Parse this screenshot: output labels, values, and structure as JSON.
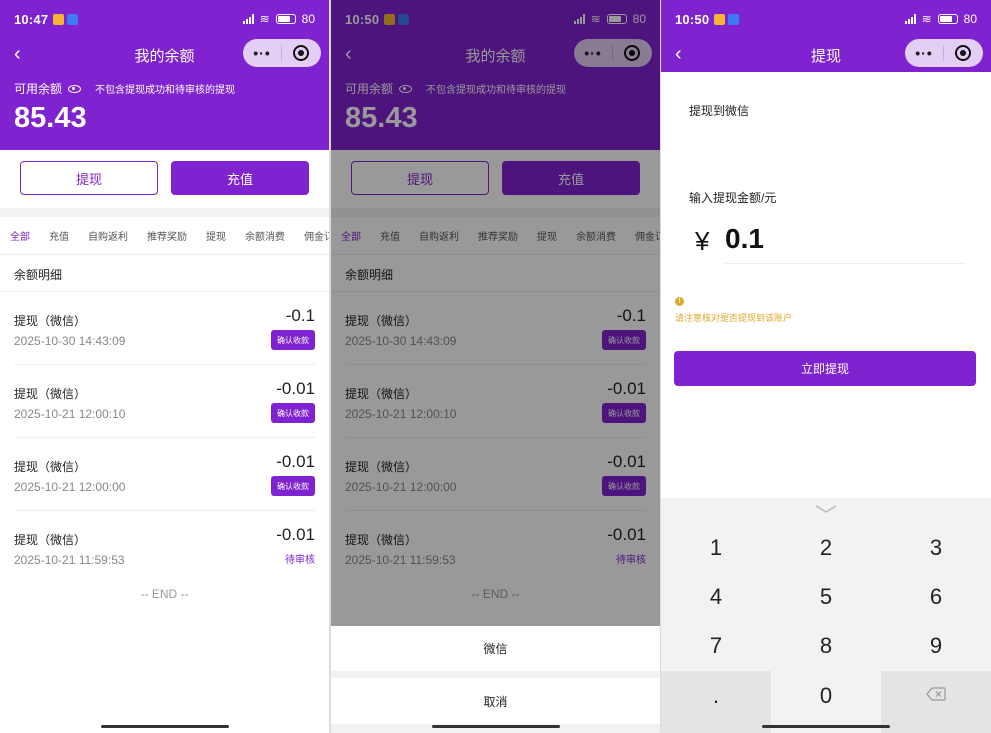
{
  "status_time_1": "10:47",
  "status_time_2": "10:50",
  "status_time_3": "10:50",
  "network": "5G",
  "battery": "80",
  "battery_unit": "%",
  "balance_page": {
    "title": "我的余额",
    "available_label": "可用余额",
    "note": "不包含提现成功和待审核的提现",
    "amount": "85.43",
    "withdraw_label": "提现",
    "recharge_label": "充值",
    "tabs": [
      "全部",
      "充值",
      "自购返利",
      "推荐奖励",
      "提现",
      "余额消费",
      "佣金订"
    ],
    "section_title": "余额明细",
    "records": [
      {
        "name": "提现（微信）",
        "date": "2025-10-30 14:43:09",
        "amount": "-0.1",
        "action": "确认收款"
      },
      {
        "name": "提现（微信）",
        "date": "2025-10-21 12:00:10",
        "amount": "-0.01",
        "action": "确认收款"
      },
      {
        "name": "提现（微信）",
        "date": "2025-10-21 12:00:00",
        "amount": "-0.01",
        "action": "确认收款"
      },
      {
        "name": "提现（微信）",
        "date": "2025-10-21 11:59:53",
        "amount": "-0.01",
        "status": "待审核"
      }
    ],
    "end_text": "-- END --"
  },
  "action_sheet": {
    "option": "微信",
    "cancel": "取消"
  },
  "withdraw_page": {
    "title": "提现",
    "to_label": "提现到微信",
    "amount_label": "输入提现金额/元",
    "currency": "¥",
    "amount_value": "0.1",
    "warning": "请注意核对是否提现到该账户",
    "submit_label": "立即提现",
    "keys": [
      "1",
      "2",
      "3",
      "4",
      "5",
      "6",
      "7",
      "8",
      "9",
      ".",
      "0"
    ]
  },
  "colors": {
    "brand": "#7f22cf",
    "warning": "#e0a72a"
  }
}
